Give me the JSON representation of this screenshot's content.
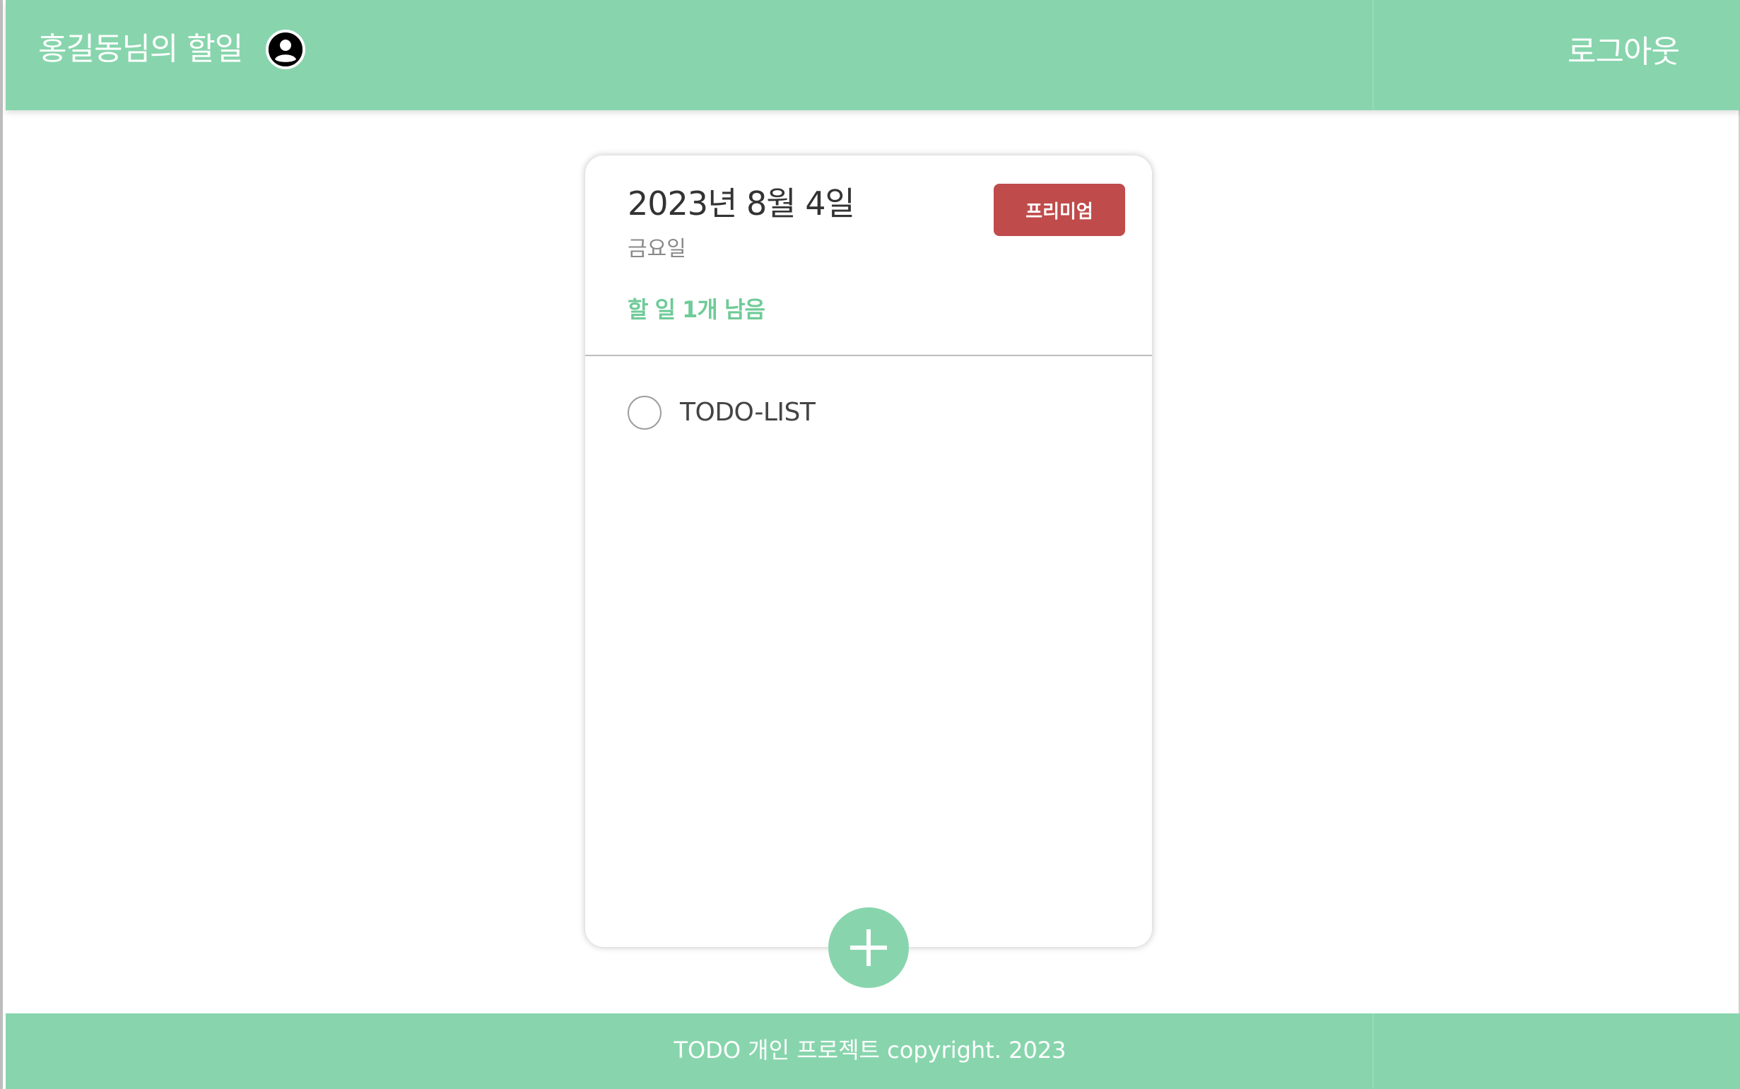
{
  "header": {
    "title": "홍길동님의 할일",
    "logout_label": "로그아웃"
  },
  "card": {
    "date": "2023년 8월 4일",
    "weekday": "금요일",
    "remaining": "할 일 1개 남음",
    "premium_label": "프리미엄",
    "todos": [
      {
        "text": "TODO-LIST",
        "done": false
      }
    ]
  },
  "footer": {
    "text": "TODO 개인 프로젝트 copyright. 2023"
  },
  "icons": {
    "profile": "user-circle-icon",
    "add": "plus-icon"
  },
  "colors": {
    "brand": "#88d5ad",
    "accent_text": "#6fcb98",
    "premium": "#c04b4b"
  }
}
